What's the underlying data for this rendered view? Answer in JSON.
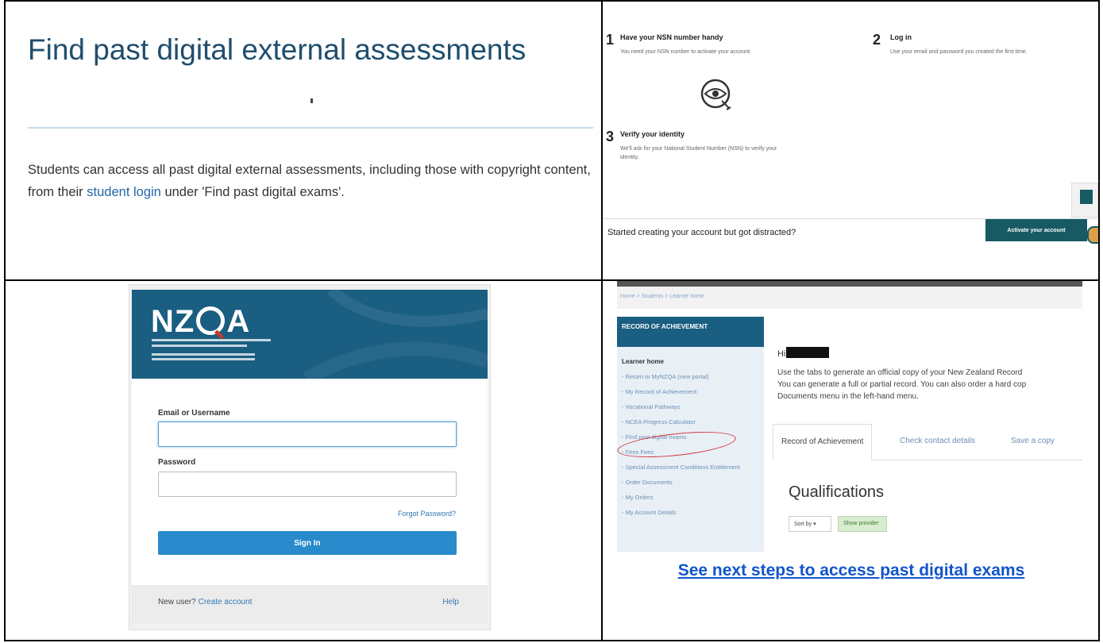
{
  "panel1": {
    "title": "Find past digital external assessments",
    "text_before": "Students can access all past digital external assessments, including those with copyright content, from their ",
    "link": "student login",
    "text_after": " under 'Find past digital exams'."
  },
  "panel2": {
    "steps": [
      {
        "num": "1",
        "title": "Have your NSN number handy",
        "desc": "You need your NSN number to activate your account."
      },
      {
        "num": "2",
        "title": "Log in",
        "desc": "Use your email and password you created the first time."
      },
      {
        "num": "3",
        "title": "Verify your identity",
        "desc": "We'll ask for your National Student Number (NSN) to verify your identity."
      }
    ],
    "distracted": "Started creating your account but got distracted?",
    "activate_button": "Activate your account",
    "icons": {
      "eye": "eye-icon"
    }
  },
  "panel3": {
    "logo": {
      "left": "NZ",
      "right": "A"
    },
    "email_label": "Email or Username",
    "email_value": "",
    "password_label": "Password",
    "password_value": "",
    "forgot": "Forgot Password?",
    "signin": "Sign In",
    "new_user": "New user?",
    "create_account": "Create account",
    "help": "Help"
  },
  "panel4": {
    "breadcrumb": "Home > Students > Learner home",
    "sidebar_header": "RECORD OF ACHIEVEMENT",
    "sidebar_title": "Learner home",
    "sidebar_links": [
      "- Return to MyNZQA (new portal)",
      "- My Record of Achievement",
      "- Vocational Pathways",
      "- NCEA Progress Calculator",
      "- Find past digital exams",
      "- Fees Fees",
      "- Special Assessment Conditions Entitlement",
      "- Order Documents",
      "- My Orders",
      "- My Account Details"
    ],
    "greeting": "Hi",
    "intro_lines": [
      "Use the tabs to generate an official copy of your New Zealand Record",
      "You can generate a full or partial record. You can also order a hard cop",
      "Documents menu in the left-hand menu."
    ],
    "tabs": [
      "Record of Achievement",
      "Check contact details",
      "Save a copy"
    ],
    "qualifications": "Qualifications",
    "sort_by": "Sort by ▾",
    "show_provider": "Show provider",
    "next_steps_link": "See next steps to access past digital exams"
  }
}
